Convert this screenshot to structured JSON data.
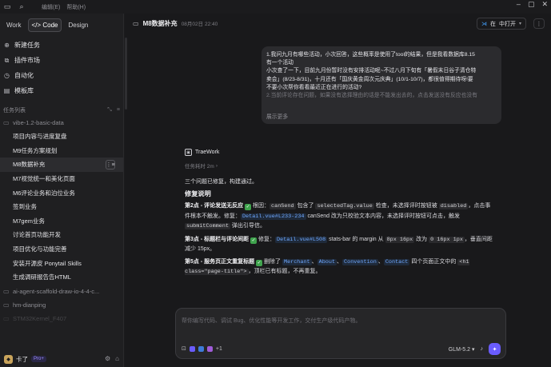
{
  "topbar": {
    "menu_edit": "编辑(E)",
    "menu_help": "帮助(H)"
  },
  "modes": [
    "Work",
    "Code",
    "Design"
  ],
  "nav": [
    {
      "icon": "plus-icon",
      "label": "新建任务"
    },
    {
      "icon": "plugin-icon",
      "label": "插件市场"
    },
    {
      "icon": "clock-icon",
      "label": "自动化"
    },
    {
      "icon": "document-icon",
      "label": "模板库"
    }
  ],
  "section_title": "任务列表",
  "group1": "vibe-1.2-basic-data",
  "tasks": [
    "项目内容与进度复盘",
    "M9任务方案规划",
    "M8数据补充",
    "M7视觉统一和美化页面",
    "M6评论业务和泊位业务",
    "签到业务",
    "M7gem业务",
    "讨论首页功能开发",
    "项目优化与功能完善",
    "安装开源皮 Ponytail Skills",
    "生成调研报告告HTML"
  ],
  "active_task_index": 2,
  "group2": "ai-agent-scaffold-draw-io-4-4-c...",
  "group3": "hm-dianping",
  "group4": "STM32Kernel_F407",
  "user": {
    "name": "卡了",
    "badge": "Pro+"
  },
  "header": {
    "title": "M8数据补充",
    "date": "08月02日 22:40",
    "open_label": "中打开"
  },
  "bubble": {
    "lines": [
      "1.我问九月有哪些活动，小次回答，这些概率是使用了tool的结果，但是我看数据库8.15",
      "有一个活动",
      "小次查了一下，目前九月份暂时没有安排活动呢~不过八月下旬有「暑假末日谷子清仓特",
      "卖会」(8/23-8/31)，十月还有「国庆黄金周次元庆典」(10/1-10/7)，都很值得期待呀!要",
      "不要小次帮你看看最近正在进行的活动?",
      "2.当前评论存在问题，如果没有选择理由的话是不能发出去的，点击发送没有反应也没有"
    ],
    "expand": "展示更多"
  },
  "assistant": {
    "brand": "TraeWork",
    "elapsed": "任务耗时 2m",
    "intro": "三个问题已修复，构建通过。",
    "heading": "修复说明",
    "items": [
      {
        "title": "第2点 - 评论发送无反应",
        "parts": [
          "根因：",
          "canSend",
          " 包含了 ",
          "selectedTag.value",
          " 检查，未选择评时按钮被 ",
          "disabled",
          "，点击事件根本不触发。修复：",
          "Detail.vue#L233-234",
          " canSend 改为只校验文本内容，未选择评时按钮可点击，触发 ",
          "submitComment",
          " 弹出引导信。"
        ]
      },
      {
        "title": "第3点 - 标题栏与评论间距",
        "parts": [
          "修复：",
          "Detail.vue#L508",
          " stats-bar 的 margin 从 ",
          "8px 16px",
          " 改为 ",
          "0 16px 1px",
          "，垂直间距减少 15px。"
        ]
      },
      {
        "title": "第5点 - 服务页正文重复标题",
        "parts": [
          "删除了 ",
          "Merchant",
          "、",
          "About",
          "、",
          "Convention",
          "、",
          "Contact",
          " 四个页面正文中的 ",
          "<h1 class=\"page-title\">",
          "，顶栏已有标题，不再重复。"
        ]
      }
    ]
  },
  "composer": {
    "placeholder": "帮你编写代码、调试 Bug、优化性能等开发工作，交付生产级代码产物。",
    "plus_count": "+1",
    "model": "GLM-5.2"
  }
}
